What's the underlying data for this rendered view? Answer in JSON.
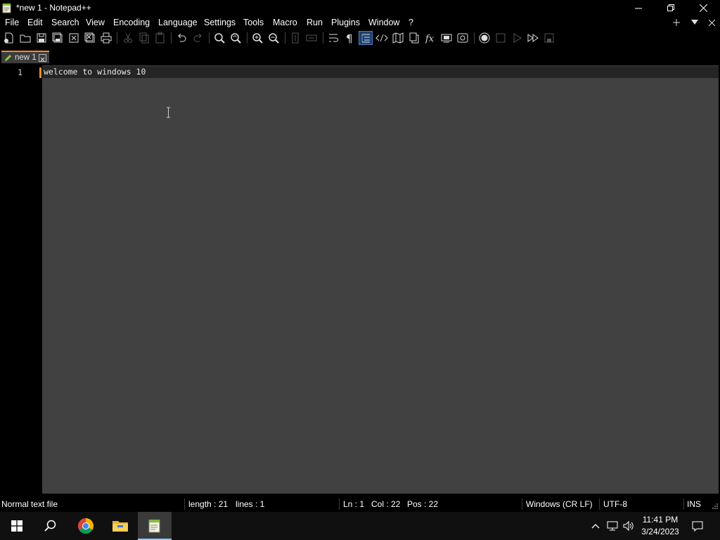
{
  "window": {
    "title": "*new 1 - Notepad++",
    "controls": [
      "minimize",
      "restore",
      "close"
    ]
  },
  "menu": {
    "items": [
      "File",
      "Edit",
      "Search",
      "View",
      "Encoding",
      "Language",
      "Settings",
      "Tools",
      "Macro",
      "Run",
      "Plugins",
      "Window",
      "?"
    ],
    "right_icons": [
      "plus-icon",
      "dropdown-arrow-icon",
      "close-icon"
    ]
  },
  "toolbar": {
    "icons": [
      "new-file-icon",
      "open-file-icon",
      "save-icon",
      "save-all-icon",
      "close-icon",
      "close-all-icon",
      "print-icon",
      "cut-icon",
      "copy-icon",
      "paste-icon",
      "undo-icon",
      "redo-icon",
      "find-icon",
      "replace-icon",
      "zoom-in-icon",
      "zoom-out-icon",
      "sync-vertical-icon",
      "sync-horizontal-icon",
      "word-wrap-icon",
      "show-all-characters-icon",
      "indent-guide-icon",
      "xml-tags-icon",
      "document-map-icon",
      "document-list-icon",
      "function-list-icon",
      "folder-as-workspace-icon",
      "monitoring-icon",
      "record-macro-icon",
      "stop-recording-icon",
      "play-macro-icon",
      "run-macro-multiple-icon",
      "save-macro-icon"
    ]
  },
  "tabs": [
    {
      "label": "new 1",
      "active": true,
      "modified": true
    }
  ],
  "editor": {
    "lines": [
      {
        "number": "1",
        "text": "welcome to windows 10"
      }
    ],
    "background": "#414141",
    "accent": "#f08c28"
  },
  "status": {
    "file_type": "Normal text file",
    "length": "length : 21",
    "lines": "lines : 1",
    "ln": "Ln : 1",
    "col": "Col : 22",
    "pos": "Pos : 22",
    "eol": "Windows (CR LF)",
    "encoding": "UTF-8",
    "mode": "INS"
  },
  "taskbar": {
    "apps": [
      "start-icon",
      "search-icon",
      "chrome-icon",
      "file-explorer-icon",
      "notepad-plus-plus-icon"
    ],
    "active_app": "notepad-plus-plus-icon",
    "tray": [
      "show-hidden-icons-chevron",
      "network-icon",
      "volume-icon"
    ],
    "time": "11:41 PM",
    "date": "3/24/2023",
    "notification_icon": "notification-icon"
  }
}
